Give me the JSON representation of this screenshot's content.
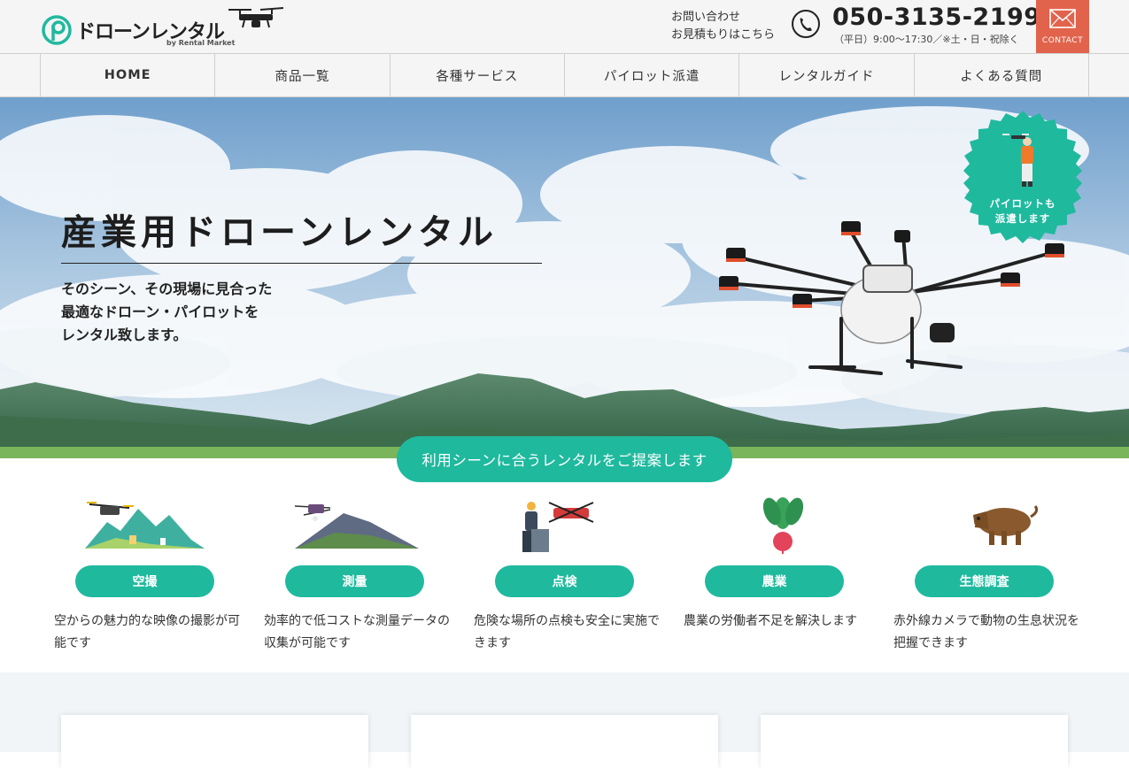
{
  "header": {
    "logo_text": "ドローンレンタル",
    "logo_sub": "by Rental Market",
    "inquiry_line1": "お問い合わせ",
    "inquiry_line2": "お見積もりはこちら",
    "phone_number": "050-3135-2199",
    "phone_hours": "（平日）9:00〜17:30／※土・日・祝除く",
    "contact_label": "CONTACT"
  },
  "nav": {
    "items": [
      {
        "label": "HOME"
      },
      {
        "label": "商品一覧"
      },
      {
        "label": "各種サービス"
      },
      {
        "label": "パイロット派遣"
      },
      {
        "label": "レンタルガイド"
      },
      {
        "label": "よくある質問"
      }
    ]
  },
  "hero": {
    "title": "産業用ドローンレンタル",
    "lead": "そのシーン、その現場に見合った\n最適なドローン・パイロットを\nレンタル致します。",
    "badge": "パイロットも\n派遣します"
  },
  "services": {
    "heading": "利用シーンに合うレンタルをご提案します",
    "items": [
      {
        "label": "空撮",
        "desc": "空からの魅力的な映像の撮影が可能です"
      },
      {
        "label": "測量",
        "desc": "効率的で低コストな測量データの収集が可能です"
      },
      {
        "label": "点検",
        "desc": "危険な場所の点検も安全に実施できます"
      },
      {
        "label": "農業",
        "desc": "農業の労働者不足を解決します"
      },
      {
        "label": "生態調査",
        "desc": "赤外線カメラで動物の生息状況を把握できます"
      }
    ]
  },
  "colors": {
    "accent": "#1fb99e",
    "contact": "#e2634c",
    "header_bg": "#f5f5f5"
  }
}
